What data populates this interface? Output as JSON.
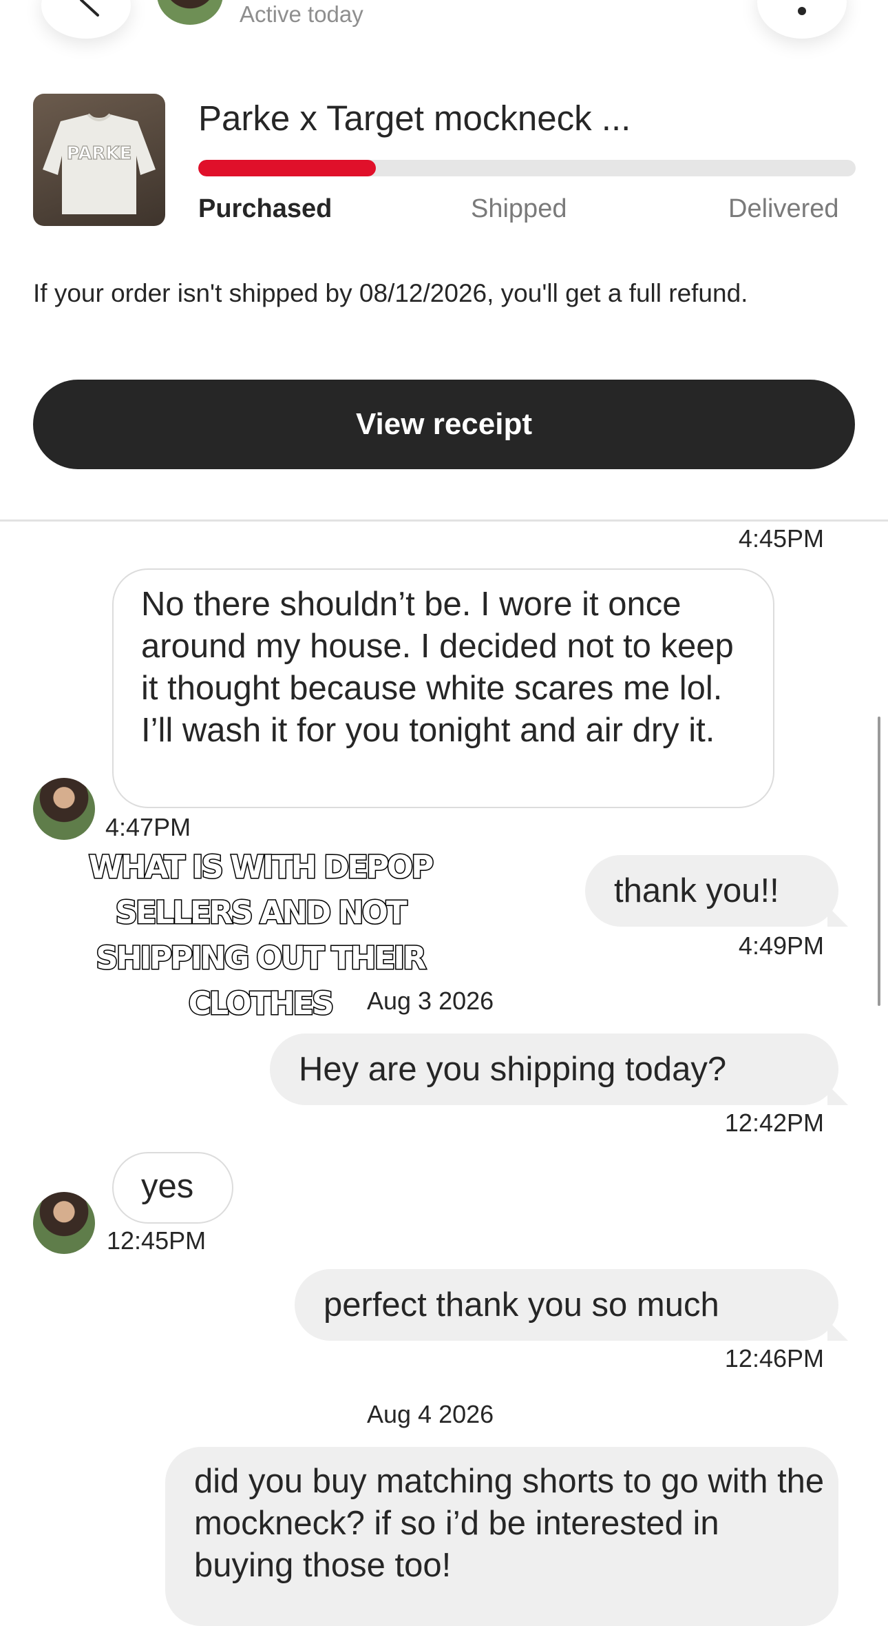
{
  "header": {
    "status": "Active today"
  },
  "order": {
    "title": "Parke x Target mockneck ...",
    "thumbnail_text": "PARKE",
    "progress_fraction": 0.27,
    "stages": [
      "Purchased",
      "Shipped",
      "Delivered"
    ],
    "current_stage": "Purchased",
    "refund_notice": "If your order isn't shipped by 08/12/2026, you'll get a full refund.",
    "view_receipt_label": "View receipt"
  },
  "chat": {
    "t1": "4:45PM",
    "m1_text": "No there shouldn’t be. I wore it once around my house. I decided not to keep it thought because white scares me lol. I’ll wash it for you tonight and air dry it.",
    "t2": "4:47PM",
    "m2_text": "thank you!!",
    "t3": "4:49PM",
    "date1": "Aug 3 2026",
    "m3_text": "Hey are you shipping today?",
    "t4": "12:42PM",
    "m4_text": "yes",
    "t5": "12:45PM",
    "m5_text": "perfect thank you so much",
    "t6": "12:46PM",
    "date2": "Aug 4 2026",
    "m6_text": "did you buy matching shorts to go with the mockneck? if so i’d be interested in buying those too!"
  },
  "overlay": {
    "caption": "WHAT IS WITH DEPOP SELLERS AND NOT SHIPPING OUT THEIR CLOTHES"
  },
  "colors": {
    "accent_red": "#e0102a",
    "button_dark": "#262626",
    "bubble_grey": "#efefef"
  }
}
